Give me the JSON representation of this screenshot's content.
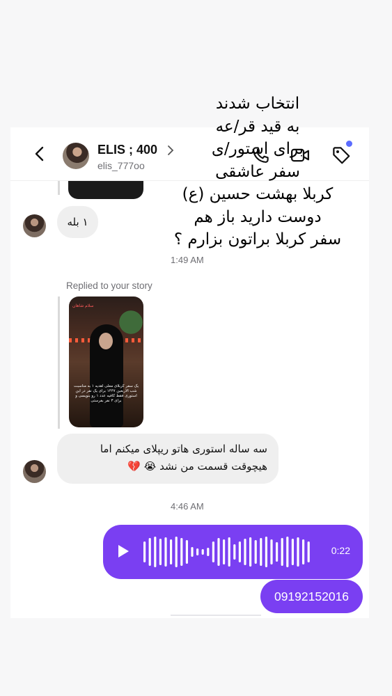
{
  "header": {
    "name": "ELIS ; 400",
    "username": "elis_777oo",
    "icons": [
      "back-chevron-icon",
      "chevron-right-icon",
      "phone-icon",
      "video-icon",
      "tag-icon"
    ],
    "accent_dot_color": "#5b6cff"
  },
  "messages": {
    "reply_one": "۱ بله",
    "time_1": "1:49 AM",
    "replied_label": "Replied to your story",
    "story_caption_top": "سلام شاهان",
    "story_caption": "یک سفر کربلای معلی اهدیه ۱ به مناسبت شب الاربعین ۱۴۴۷ برای یک نفر در این استوری فقط کافیه عدد ۱ رو بنویسی و برای ۳ نفر بفرستی",
    "long_reply_line1": "سه ساله استوری هاتو ریپلای میکنم اما",
    "long_reply_line2": "هیچوقت قسمت من نشد 😭 💔",
    "time_2": "4:46 AM",
    "voice_duration": "0:22",
    "phone_number": "09192152016"
  },
  "overlay_text": [
    "انتخاب شدند",
    "به قید قر/عه",
    "برای استور/ی",
    "سفر عاشقی",
    "کربلا بهشت حسین (ع)",
    "دوست دارید باز هم",
    "سفر کربلا براتون بزارم ؟"
  ],
  "colors": {
    "outgoing_bubble": "#7a3ff2",
    "incoming_bubble": "#efefef"
  }
}
